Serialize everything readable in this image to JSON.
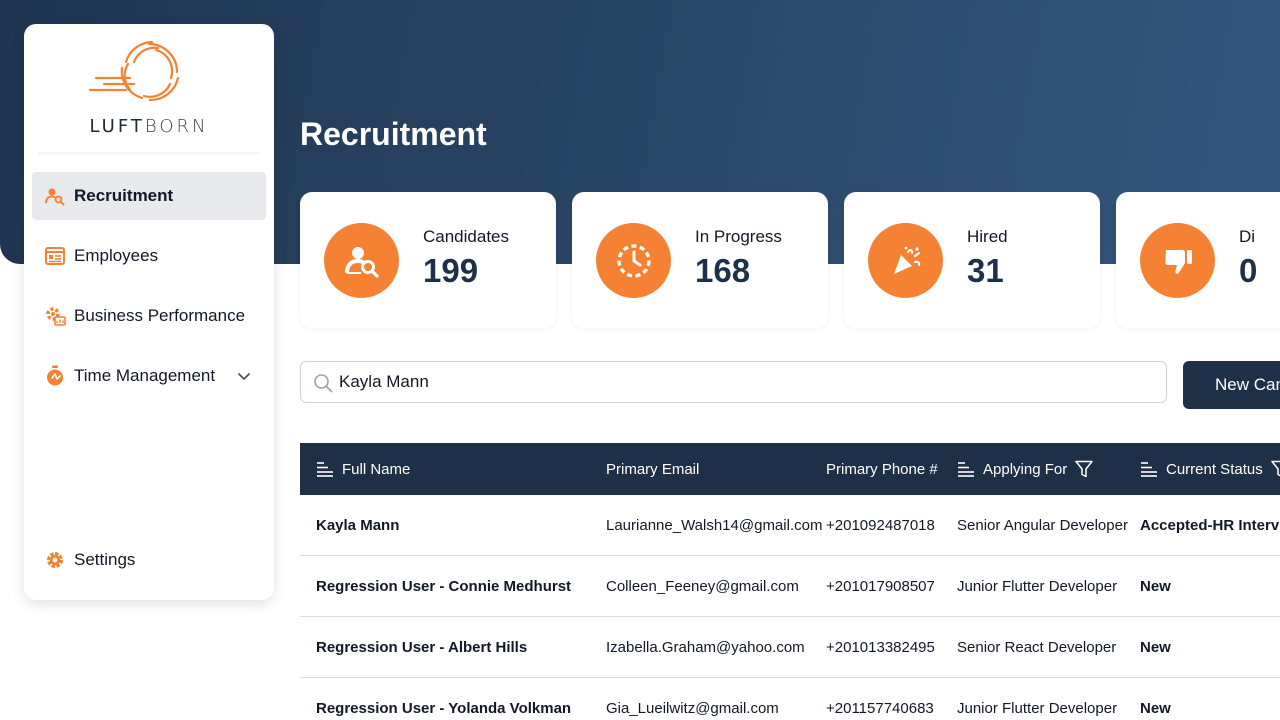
{
  "brand": {
    "logo_text_bold": "LUFT",
    "logo_text_light": "BORN",
    "accent": "#f58233",
    "navy": "#1e3048"
  },
  "sidebar": {
    "items": [
      {
        "label": "Recruitment",
        "icon": "recruitment-icon",
        "active": true
      },
      {
        "label": "Employees",
        "icon": "employees-icon"
      },
      {
        "label": "Business Performance",
        "icon": "business-performance-icon"
      },
      {
        "label": "Time Management",
        "icon": "time-management-icon",
        "expandable": true
      }
    ],
    "settings": {
      "label": "Settings",
      "icon": "gear-icon"
    }
  },
  "page": {
    "title": "Recruitment"
  },
  "stats": [
    {
      "label": "Candidates",
      "value": "199",
      "icon": "candidates-icon"
    },
    {
      "label": "In Progress",
      "value": "168",
      "icon": "in-progress-icon"
    },
    {
      "label": "Hired",
      "value": "31",
      "icon": "hired-icon"
    },
    {
      "label": "Di",
      "value": "0",
      "icon": "thumbs-down-icon"
    }
  ],
  "search": {
    "value": "Kayla Mann",
    "placeholder": ""
  },
  "new_button": {
    "label": "New Can"
  },
  "table": {
    "headers": {
      "full_name": "Full Name",
      "email": "Primary Email",
      "phone": "Primary Phone #",
      "applying_for": "Applying For",
      "status": "Current Status"
    },
    "rows": [
      {
        "name": "Kayla Mann",
        "email": "Laurianne_Walsh14@gmail.com",
        "phone": "+201092487018",
        "applying_for": "Senior Angular Developer",
        "status": "Accepted-HR Intervi"
      },
      {
        "name": "Regression User - Connie Medhurst",
        "email": "Colleen_Feeney@gmail.com",
        "phone": "+201017908507",
        "applying_for": "Junior Flutter Developer",
        "status": "New"
      },
      {
        "name": "Regression User - Albert Hills",
        "email": "Izabella.Graham@yahoo.com",
        "phone": "+201013382495",
        "applying_for": "Senior React Developer",
        "status": "New"
      },
      {
        "name": "Regression User - Yolanda Volkman",
        "email": "Gia_Lueilwitz@gmail.com",
        "phone": "+201157740683",
        "applying_for": "Junior Flutter Developer",
        "status": "New"
      }
    ]
  }
}
